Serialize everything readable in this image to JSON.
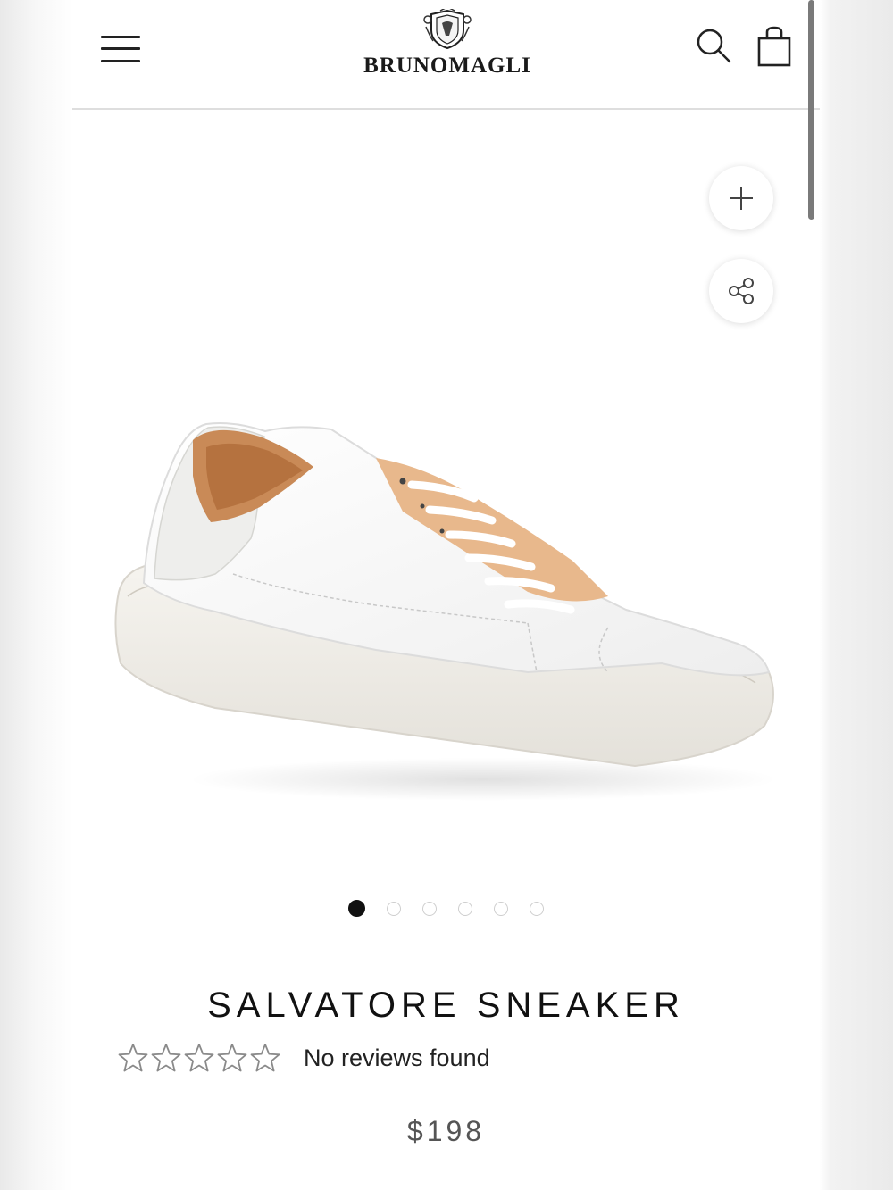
{
  "header": {
    "brand": "BRUNOMAGLI",
    "menu_icon": "hamburger-menu-icon",
    "search_icon": "search-icon",
    "cart_icon": "shopping-bag-icon"
  },
  "gallery": {
    "zoom_icon": "plus-icon",
    "share_icon": "share-icon",
    "image_count": 6,
    "active_index": 0
  },
  "product": {
    "title": "SALVATORE SNEAKER",
    "rating": 0,
    "rating_max": 5,
    "reviews_text": "No reviews found",
    "price": "$198"
  },
  "colors": {
    "text": "#111111",
    "price": "#555555",
    "divider": "#dedede"
  }
}
